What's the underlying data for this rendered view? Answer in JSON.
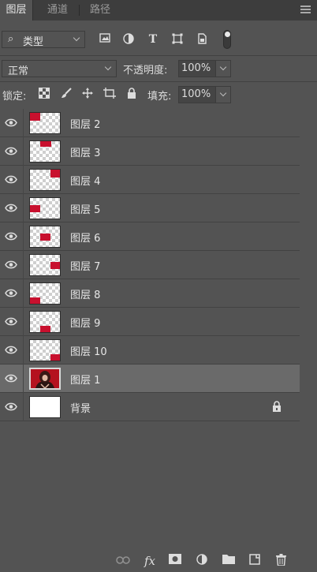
{
  "tabs": [
    {
      "label": "图层",
      "active": true
    },
    {
      "label": "通道",
      "active": false
    },
    {
      "label": "路径",
      "active": false
    }
  ],
  "filter": {
    "kind_label": "类型"
  },
  "blend": {
    "mode": "正常",
    "opacity_label": "不透明度:",
    "opacity_value": "100%"
  },
  "lock": {
    "label": "锁定:",
    "fill_label": "填充:",
    "fill_value": "100%"
  },
  "layers": [
    {
      "name": "图层 2",
      "thumb": "transparent"
    },
    {
      "name": "图层 3",
      "thumb": "transparent"
    },
    {
      "name": "图层 4",
      "thumb": "transparent"
    },
    {
      "name": "图层 5",
      "thumb": "transparent"
    },
    {
      "name": "图层 6",
      "thumb": "transparent"
    },
    {
      "name": "图层 7",
      "thumb": "transparent"
    },
    {
      "name": "图层 8",
      "thumb": "transparent"
    },
    {
      "name": "图层 9",
      "thumb": "transparent"
    },
    {
      "name": "图层 10",
      "thumb": "transparent"
    },
    {
      "name": "图层 1",
      "thumb": "photo",
      "selected": true
    },
    {
      "name": "背景",
      "thumb": "white",
      "locked": true
    }
  ],
  "colors": {
    "panel_bg": "#535353",
    "selected_row": "#6a6a6a",
    "thumb_red": "#c8102e"
  }
}
